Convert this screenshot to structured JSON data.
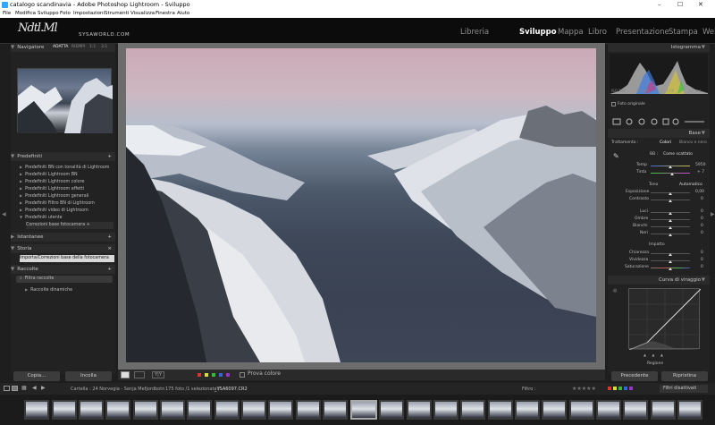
{
  "window": {
    "title": "catalogo scandinavia - Adobe Photoshop Lightroom - Sviluppo",
    "controls": [
      "–",
      "☐",
      "✕"
    ]
  },
  "menu": [
    "File",
    "Modifica",
    "Sviluppo",
    "Foto",
    "Impostazioni",
    "Strumenti",
    "Visualizza",
    "Finestra",
    "Aiuto"
  ],
  "identity": {
    "signature": "Ndtl.Ml",
    "site": "SYSAWORLD.COM"
  },
  "modules": [
    {
      "label": "Libreria"
    },
    {
      "label": "Sviluppo"
    },
    {
      "label": "Mappa"
    },
    {
      "label": "Libro"
    },
    {
      "label": "Presentazione"
    },
    {
      "label": "Stampa"
    },
    {
      "label": "Web"
    }
  ],
  "left": {
    "navigator": {
      "title": "Navigatore",
      "opts": [
        "ADATTA",
        "RIEMPI",
        "1:1",
        "3:1"
      ]
    },
    "snapshots": {
      "title": "Istantanee"
    },
    "presets": {
      "title": "Predefiniti",
      "items": [
        "Predefiniti BN con tonalità di Lightroom",
        "Predefiniti Lightroom BN",
        "Predefiniti Lightroom colore",
        "Predefiniti Lightroom effetti",
        "Predefiniti Lightroom generali",
        "Predefiniti Filtro BN di Lightroom",
        "Predefiniti video di Lightroom",
        "Predefiniti utente"
      ],
      "subitem": "Correzioni base fotocamera +"
    },
    "history": {
      "title": "Storia",
      "item": "Importa/Correzioni base della fotocamera (6..."
    },
    "collections": {
      "title": "Raccolte",
      "filter": "Filtra raccolte",
      "smart": "Raccolte dinamiche"
    },
    "buttons": {
      "copy": "Copia...",
      "paste": "Incolla"
    }
  },
  "toolbar": {
    "proof": "Prova colore"
  },
  "right": {
    "histogram": {
      "title": "Istogramma",
      "readout": [
        "ISO 100",
        "20 mm",
        "f / 9",
        "1/2 sec"
      ],
      "original": "Foto originale"
    },
    "basic": {
      "title": "Base",
      "treatment": "Trattamento :",
      "color": "Colori",
      "bw": "Bianco e nero",
      "wb_label": "BB :",
      "wb_value": "Come scattato",
      "temp_label": "Temp",
      "temp_value": "5950",
      "tint_label": "Tinta",
      "tint_value": "+ 7",
      "tone": "Tono",
      "auto": "Automatico",
      "exposure": "Esposizione",
      "exposure_value": "0,00",
      "contrast": "Contrasto",
      "contrast_value": "0",
      "highlights": "Luci",
      "highlights_value": "0",
      "shadows": "Ombre",
      "shadows_value": "0",
      "whites": "Bianchi",
      "whites_value": "0",
      "blacks": "Neri",
      "blacks_value": "0",
      "presence": "Impatto",
      "clarity": "Chiarezza",
      "clarity_value": "0",
      "vibrance": "Vividezza",
      "vibrance_value": "0",
      "saturation": "Saturazione",
      "saturation_value": "0"
    },
    "tone_curve": {
      "title": "Curva di viraggio",
      "region": "Regione"
    },
    "buttons": {
      "previous": "Precedente",
      "reset": "Ripristina"
    }
  },
  "filmstrip": {
    "pages": [
      "1",
      "2"
    ],
    "path": "Cartella : 24 Norvegia - Senja Mefjordbotn",
    "count": "175 foto /1 selezionata /",
    "file": "_YSA6097.CR2",
    "filter_label": "Filtro :",
    "filter_state": "Filtri disattivati"
  }
}
